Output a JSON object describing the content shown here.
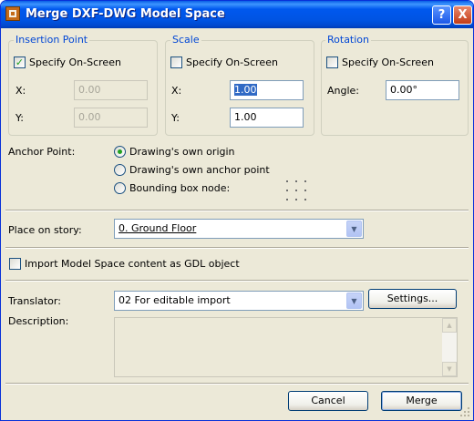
{
  "window": {
    "title": "Merge DXF-DWG Model Space",
    "help_label": "?",
    "close_label": "X"
  },
  "insertion": {
    "title": "Insertion Point",
    "specify_label": "Specify On-Screen",
    "specify_checked": true,
    "x_label": "X:",
    "x_value": "0.00",
    "y_label": "Y:",
    "y_value": "0.00"
  },
  "scale": {
    "title": "Scale",
    "specify_label": "Specify On-Screen",
    "specify_checked": false,
    "x_label": "X:",
    "x_value": "1.00",
    "y_label": "Y:",
    "y_value": "1.00"
  },
  "rotation": {
    "title": "Rotation",
    "specify_label": "Specify On-Screen",
    "specify_checked": false,
    "angle_label": "Angle:",
    "angle_value": "0.00°"
  },
  "anchor": {
    "label": "Anchor Point:",
    "options": [
      "Drawing's own origin",
      "Drawing's own anchor point",
      "Bounding box node:"
    ],
    "selected_index": 0
  },
  "story": {
    "label": "Place on story:",
    "value": "0. Ground Floor"
  },
  "import_gdl": {
    "label": "Import Model Space content as GDL object",
    "checked": false
  },
  "translator": {
    "label": "Translator:",
    "value": "02 For editable import",
    "settings_label": "Settings..."
  },
  "description": {
    "label": "Description:"
  },
  "footer": {
    "cancel_label": "Cancel",
    "merge_label": "Merge"
  }
}
